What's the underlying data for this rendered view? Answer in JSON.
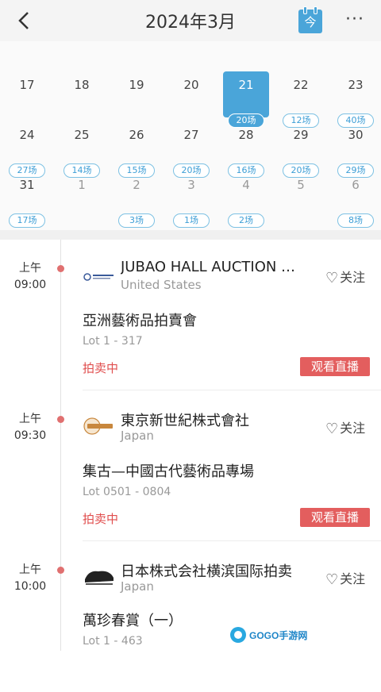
{
  "header": {
    "title": "2024年3月",
    "today_label": "今",
    "more_label": "···"
  },
  "icons": {
    "back": "chevron-left-icon",
    "today": "calendar-today-icon",
    "more": "more-dots-icon",
    "heart": "heart-outline-icon"
  },
  "colors": {
    "accent": "#4aa5d9",
    "live_red": "#e35e5e",
    "status_red": "#e04e4e",
    "dot": "#e07070"
  },
  "calendar": {
    "selected": "21",
    "days": [
      {
        "num": "17",
        "count": ""
      },
      {
        "num": "18",
        "count": ""
      },
      {
        "num": "19",
        "count": ""
      },
      {
        "num": "20",
        "count": ""
      },
      {
        "num": "21",
        "count": "20场"
      },
      {
        "num": "22",
        "count": "12场"
      },
      {
        "num": "23",
        "count": "40场"
      },
      {
        "num": "24",
        "count": "27场"
      },
      {
        "num": "25",
        "count": "14场"
      },
      {
        "num": "26",
        "count": "15场"
      },
      {
        "num": "27",
        "count": "20场"
      },
      {
        "num": "28",
        "count": "16场"
      },
      {
        "num": "29",
        "count": "20场"
      },
      {
        "num": "30",
        "count": "29场"
      },
      {
        "num": "31",
        "count": "17场"
      },
      {
        "num": "1",
        "count": ""
      },
      {
        "num": "2",
        "count": "3场"
      },
      {
        "num": "3",
        "count": "1场"
      },
      {
        "num": "4",
        "count": "2场"
      },
      {
        "num": "5",
        "count": ""
      },
      {
        "num": "6",
        "count": "8场"
      }
    ]
  },
  "events": [
    {
      "period": "上午",
      "time": "09:00",
      "house": "JUBAO HALL AUCTION …",
      "country": "United States",
      "follow": "关注",
      "title": "亞洲藝術品拍賣會",
      "lot": "Lot 1 - 317",
      "status": "拍卖中",
      "live": "观看直播"
    },
    {
      "period": "上午",
      "time": "09:30",
      "house": "東京新世紀株式會社",
      "country": "Japan",
      "follow": "关注",
      "title": "集古—中國古代藝術品專場",
      "lot": "Lot 0501 - 0804",
      "status": "拍卖中",
      "live": "观看直播"
    },
    {
      "period": "上午",
      "time": "10:00",
      "house": "日本株式会社横滨国际拍卖",
      "country": "Japan",
      "follow": "关注",
      "title": "萬珍春賞（一）",
      "lot": "Lot 1 - 463",
      "status": "",
      "live": ""
    }
  ],
  "watermark": {
    "text": "GOGO手游网"
  }
}
